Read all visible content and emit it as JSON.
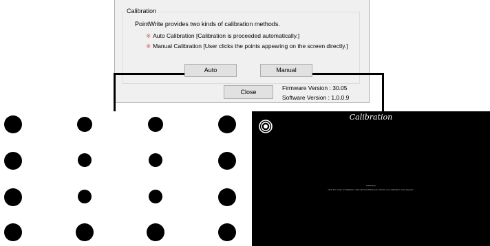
{
  "dialog": {
    "group_title": "Calibration",
    "description": "PointWrite provides two kinds of calibration methods.",
    "option_mark": "※",
    "option_auto": "Auto Calibration [Calibration is proceeded automatically.]",
    "option_manual": "Manual Calibration [User clicks the points appearing on the screen directly.]",
    "auto_button": "Auto",
    "manual_button": "Manual",
    "close_button": "Close",
    "firmware_version": "Firmware Version : 30.05",
    "software_version": "Software Version : 1.0.0.9"
  },
  "calibration_screen": {
    "title": "Calibration",
    "center_heading": "Calibration",
    "center_instruction": "Click the center of calibration mark with PointWrite pen until the next calibration mark appears.",
    "icon": "target-icon"
  },
  "dot_grid": {
    "rows": 4,
    "columns": 4
  },
  "colors": {
    "option_mark": "#d35a5a",
    "screen_bg": "#000000"
  }
}
